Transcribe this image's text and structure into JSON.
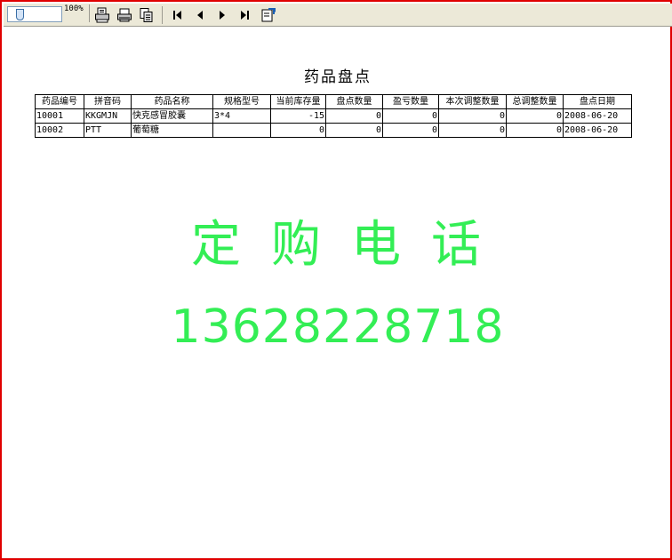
{
  "toolbar": {
    "zoom": "100%",
    "buttons": [
      {
        "name": "print-setup",
        "icon": "printer-setup-icon"
      },
      {
        "name": "print",
        "icon": "printer-icon"
      },
      {
        "name": "print-preview",
        "icon": "copy-pages-icon"
      },
      {
        "name": "first-page",
        "icon": "first-page-icon"
      },
      {
        "name": "prev-page",
        "icon": "prev-page-icon"
      },
      {
        "name": "next-page",
        "icon": "next-page-icon"
      },
      {
        "name": "last-page",
        "icon": "last-page-icon"
      },
      {
        "name": "export",
        "icon": "export-icon"
      }
    ]
  },
  "report": {
    "title": "药品盘点",
    "columns": [
      "药品编号",
      "拼音码",
      "药品名称",
      "规格型号",
      "当前库存量",
      "盘点数量",
      "盈亏数量",
      "本次调整数量",
      "总调整数量",
      "盘点日期"
    ],
    "rows": [
      [
        "10001",
        "KKGMJN",
        "快克感冒胶囊",
        "3*4",
        "-15",
        "0",
        "0",
        "0",
        "0",
        "2008-06-20"
      ],
      [
        "10002",
        "PTT",
        "葡萄糖",
        "",
        "0",
        "0",
        "0",
        "0",
        "0",
        "2008-06-20"
      ]
    ]
  },
  "watermark": {
    "line1": "定购电话",
    "line2": "13628228718",
    "color": "#33ee55"
  },
  "colors": {
    "frame": "#e00000",
    "toolbar": "#ece9d8"
  }
}
